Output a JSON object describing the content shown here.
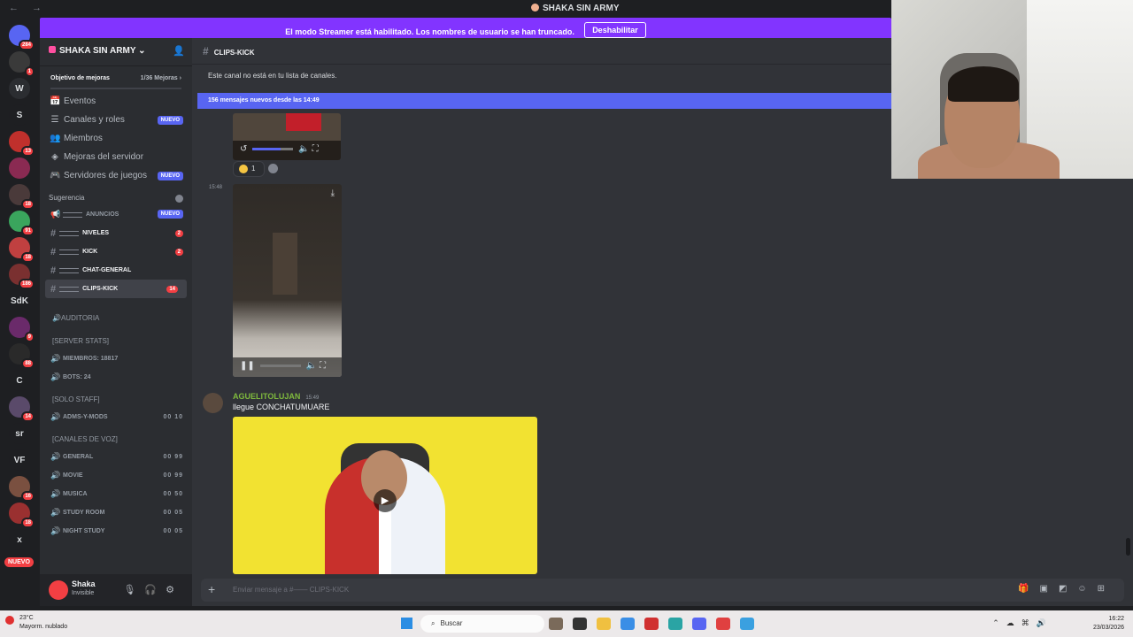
{
  "window": {
    "title": "SHAKA SIN ARMY",
    "nav": "← →"
  },
  "banner": {
    "text": "El modo Streamer está habilitado. Los nombres de usuario se han truncado.",
    "button": "Deshabilitar"
  },
  "rail": {
    "items": [
      {
        "label": "",
        "badge": "284",
        "color": "#5865f2"
      },
      {
        "label": "",
        "badge": "1",
        "color": "#3a3a3a"
      },
      {
        "label": "W",
        "badge": "",
        "color": "#2b2d31"
      },
      {
        "label": "S",
        "badge": "",
        "color": "#1e1f22"
      },
      {
        "label": "",
        "badge": "13",
        "color": "#c0302c"
      },
      {
        "label": "",
        "badge": "",
        "color": "#8a2a52"
      },
      {
        "label": "",
        "badge": "18",
        "color": "#4a3a3a"
      },
      {
        "label": "",
        "badge": "91",
        "color": "#3aa55d"
      },
      {
        "label": "",
        "badge": "18",
        "color": "#c04040"
      },
      {
        "label": "",
        "badge": "186",
        "color": "#7a3030"
      },
      {
        "label": "SdK",
        "badge": "",
        "color": "#1e1f22"
      },
      {
        "label": "",
        "badge": "9",
        "color": "#6a2a6a"
      },
      {
        "label": "",
        "badge": "88",
        "color": "#2a2a2a"
      },
      {
        "label": "C",
        "badge": "",
        "color": "#1e1f22"
      },
      {
        "label": "",
        "badge": "14",
        "color": "#5a4a6a"
      },
      {
        "label": "sr",
        "badge": "",
        "color": "#1e1f22"
      },
      {
        "label": "VF",
        "badge": "",
        "color": "#1e1f22"
      },
      {
        "label": "",
        "badge": "16",
        "color": "#7a5040"
      },
      {
        "label": "",
        "badge": "18",
        "color": "#9a3030"
      },
      {
        "label": "x",
        "badge": "",
        "color": "#1e1f22"
      }
    ],
    "new_label": "NUEVO"
  },
  "server": {
    "name": "SHAKA SIN ARMY",
    "chevron": "⌄",
    "add_icon": "👤"
  },
  "goal": {
    "label": "Objetivo de mejoras",
    "progress": "1/36 Mejoras",
    "chevron": "›"
  },
  "menu": [
    {
      "icon": "📅",
      "label": "Eventos",
      "tag": ""
    },
    {
      "icon": "☰",
      "label": "Canales y roles",
      "tag": "NUEVO"
    },
    {
      "icon": "👥",
      "label": "Miembros",
      "tag": ""
    },
    {
      "icon": "◈",
      "label": "Mejoras del servidor",
      "tag": ""
    },
    {
      "icon": "🎮",
      "label": "Servidores de juegos",
      "tag": "NUEVO"
    }
  ],
  "suggestion": {
    "label": "Sugerencia",
    "channel": "ANUNCIOS",
    "tag": "NUEVO"
  },
  "channels": [
    {
      "name": "NIVELES",
      "count": "2",
      "prefix": "#"
    },
    {
      "name": "KICK",
      "count": "2",
      "prefix": "#"
    },
    {
      "name": "CHAT-GENERAL",
      "count": "",
      "prefix": "#"
    },
    {
      "name": "CLIPS-KICK",
      "count": "14",
      "prefix": "#"
    }
  ],
  "auditoria": "AUDITORIA",
  "server_stats": {
    "header": "[SERVER STATS]",
    "items": [
      "MIEMBROS: 18817",
      "BOTS: 24"
    ]
  },
  "solo_staff": {
    "header": "[SOLO STAFF]",
    "items": [
      {
        "name": "ADMS-Y-MODS",
        "count": "00 10"
      }
    ]
  },
  "voz": {
    "header": "[CANALES DE VOZ]",
    "items": [
      {
        "name": "GENERAL",
        "count": "00 99"
      },
      {
        "name": "MOVIE",
        "count": "00 99"
      },
      {
        "name": "MUSICA",
        "count": "00 50"
      },
      {
        "name": "STUDY ROOM",
        "count": "00 05"
      },
      {
        "name": "NIGHT STUDY",
        "count": "00 05"
      }
    ]
  },
  "user": {
    "name": "Shaka",
    "status": "Invisible"
  },
  "channel_header": {
    "name": "CLIPS-KICK"
  },
  "notice": "Este canal no está en tu lista de canales.",
  "new_messages": "156 mensajes nuevos desde las 14:49",
  "messages": {
    "reaction_count": "1",
    "ts1": "15:48",
    "author": "AGUELITOLUJAN",
    "author_ts": "15:49",
    "text": "llegue CONCHATUMUARE"
  },
  "composer": {
    "placeholder": "Enviar mensaje a #—— CLIPS-KICK"
  },
  "taskbar": {
    "temp": "23°C",
    "weather": "Mayorm. nublado",
    "search": "Buscar",
    "time": "16:22",
    "date": "23/03/2026"
  }
}
